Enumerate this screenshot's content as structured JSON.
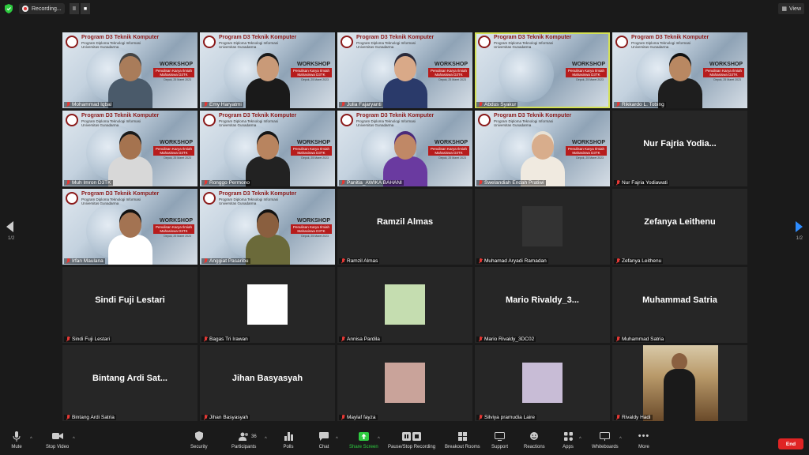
{
  "topbar": {
    "recording_label": "Recording...",
    "pause_glyph": "II",
    "stop_glyph": "■",
    "view_label": "View"
  },
  "banner": {
    "title": "Program D3 Teknik Komputer",
    "sub1": "Program Diploma Teknologi Informasi",
    "sub2": "Universitas Gunadarma",
    "workshop": "WORKSHOP",
    "ribbon1": "Penulisan Karya Ilmiah",
    "ribbon2": "Mahasiswa D3TK",
    "date": "Depok, 25 Maret 2023"
  },
  "participants": [
    {
      "name": "Mohammad Iqbal",
      "type": "video",
      "skin": "#a97c5a",
      "hair": "#444",
      "shirt": "#4a5a6a"
    },
    {
      "name": "Emy Haryatmi",
      "type": "video",
      "skin": "#c99a78",
      "hair": "#1a1a1a",
      "shirt": "#1a1a1a"
    },
    {
      "name": "Julia Fajaryanti",
      "type": "video",
      "skin": "#d9a988",
      "hair": "#2a2a3a",
      "shirt": "#2a3a6a"
    },
    {
      "name": "Abdus Syakur",
      "type": "video",
      "active": true
    },
    {
      "name": "Rikkardo L. Tobing",
      "type": "video",
      "skin": "#b98862",
      "hair": "#111",
      "shirt": "#1e1e1e"
    },
    {
      "name": "Muh Imron D3TK",
      "type": "video",
      "skin": "#a5734f",
      "hair": "#1a1a1a",
      "shirt": "#d8d8d8"
    },
    {
      "name": "Ronggo Permono",
      "type": "video",
      "skin": "#b8845f",
      "hair": "#151515",
      "shirt": "#222"
    },
    {
      "name": "Panitia_AWIKA BAHANI",
      "type": "video",
      "skin": "#c08866",
      "hair": "#4a2a7a",
      "shirt": "#6a3aa0"
    },
    {
      "name": "Swelandiah Endah Pratiwi",
      "type": "video",
      "skin": "#d8ad8c",
      "hair": "#e8e2d6",
      "shirt": "#f0eae0"
    },
    {
      "name": "Nur Fajria Yodiawati",
      "display": "Nur Fajria Yodia...",
      "type": "name"
    },
    {
      "name": "Irfan Maulana",
      "type": "video",
      "skin": "#a37352",
      "hair": "#111",
      "shirt": "#ffffff"
    },
    {
      "name": "Anggiat Pasaribu",
      "type": "video",
      "skin": "#8a5f3f",
      "hair": "#111",
      "shirt": "#6b6a3a"
    },
    {
      "name": "Ramzil Almas",
      "display": "Ramzil Almas",
      "type": "name"
    },
    {
      "name": "Muhamad Aryadi Ramadan",
      "type": "thumb",
      "color": "#333333"
    },
    {
      "name": "Zefanya Leithenu",
      "display": "Zefanya Leithenu",
      "type": "name"
    },
    {
      "name": "Sindi Fuji Lestari",
      "display": "Sindi Fuji Lestari",
      "type": "name"
    },
    {
      "name": "Bagas Tri Irawan",
      "type": "thumb",
      "color": "#ffffff"
    },
    {
      "name": "Annisa Pardila",
      "type": "thumb",
      "color": "#c5ddb0"
    },
    {
      "name": "Mario Rivaldy_3DC02",
      "display": "Mario  Rivaldy_3...",
      "type": "name"
    },
    {
      "name": "Muhammad Satria",
      "display": "Muhammad Satria",
      "type": "name"
    },
    {
      "name": "Bintang Ardi Satria",
      "display": "Bintang Ardi Sat...",
      "type": "name"
    },
    {
      "name": "Jihan Basyasyah",
      "display": "Jihan Basyasyah",
      "type": "name"
    },
    {
      "name": "Maylaf fayza",
      "type": "thumb",
      "color": "#c9a39a"
    },
    {
      "name": "Silviya pramudia Laire",
      "type": "thumb",
      "color": "#c8bcd6"
    },
    {
      "name": "Rivaldy Hadi",
      "type": "photo"
    }
  ],
  "pagination": {
    "left": "1/2",
    "right": "1/2"
  },
  "toolbar": {
    "mute": "Mute",
    "stop_video": "Stop Video",
    "security": "Security",
    "participants": "Participants",
    "participant_count": "36",
    "polls": "Polls",
    "chat": "Chat",
    "share_screen": "Share Screen",
    "pause_recording": "Pause/Stop Recording",
    "breakout": "Breakout Rooms",
    "support": "Support",
    "reactions": "Reactions",
    "apps": "Apps",
    "whiteboards": "Whiteboards",
    "more": "More",
    "end": "End"
  },
  "colors": {
    "accent_green": "#2ecc40",
    "end_red": "#e02424",
    "active_border": "#d4e157",
    "arrow_blue": "#2d8cff"
  }
}
